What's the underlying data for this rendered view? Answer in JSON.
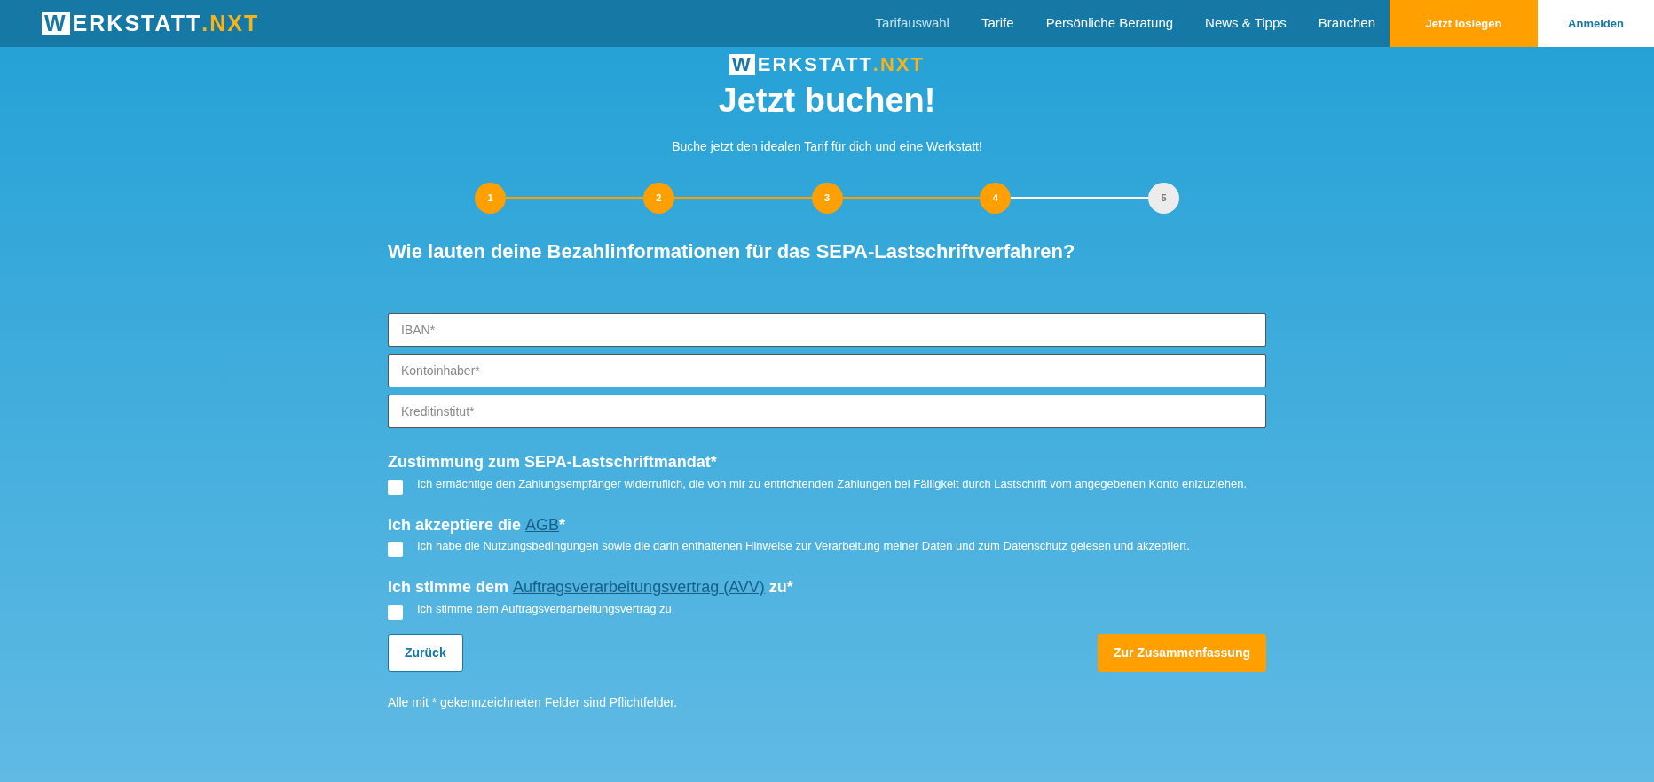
{
  "navbar": {
    "logo": {
      "boxed": "W",
      "main": "ERKSTATT",
      "accent": ".NXT"
    },
    "items": [
      {
        "label": "Tarifauswahl",
        "selected": true
      },
      {
        "label": "Tarife",
        "selected": false
      },
      {
        "label": "Persönliche Beratung",
        "selected": false
      },
      {
        "label": "News & Tipps",
        "selected": false
      },
      {
        "label": "Branchen",
        "selected": false
      }
    ],
    "cta": "Jetzt loslegen",
    "login": "Anmelden"
  },
  "header": {
    "logo": {
      "boxed": "W",
      "main": "ERKSTATT",
      "accent": ".NXT"
    },
    "title": "Jetzt buchen!",
    "subtitle": "Buche jetzt den idealen Tarif für dich und eine Werkstatt!"
  },
  "steps": [
    {
      "label": "1",
      "completed": true
    },
    {
      "label": "2",
      "completed": true
    },
    {
      "label": "3",
      "completed": true
    },
    {
      "label": "4",
      "completed": true
    },
    {
      "label": "5",
      "completed": false
    }
  ],
  "question": "Wie lauten deine Bezahlinformationen für das SEPA-Lastschriftverfahren?",
  "fields": [
    {
      "placeholder": "IBAN*"
    },
    {
      "placeholder": "Kontoinhaber*"
    },
    {
      "placeholder": "Kreditinstitut*"
    }
  ],
  "consents": [
    {
      "heading_before": "Zustimmung zum SEPA-Lastschriftmandat*",
      "text": "Ich ermächtige den Zahlungsempfänger widerruflich, die von mir zu entrichtenden Zahlungen bei Fälligkeit durch Lastschrift vom angegebenen Konto enizuziehen.",
      "checked": false
    },
    {
      "heading_before": "Ich akzeptiere die ",
      "link": "AGB",
      "heading_after": "*",
      "text": "Ich habe die Nutzungsbedingungen sowie die darin enthaltenen Hinweise zur Verarbeitung meiner Daten und zum Datenschutz gelesen und akzeptiert.",
      "checked": false
    },
    {
      "heading_before": "Ich stimme dem ",
      "link": "Auftragsverarbeitungsvertrag (AVV)",
      "heading_after": " zu*",
      "text": "Ich stimme dem Auftragsverbarbeitungsvertrag zu.",
      "checked": false
    }
  ],
  "buttons": {
    "back": "Zurück",
    "next": "Zur Zusammenfassung"
  },
  "note": "Alle mit * gekennzeichneten Felder sind Pflichtfelder."
}
